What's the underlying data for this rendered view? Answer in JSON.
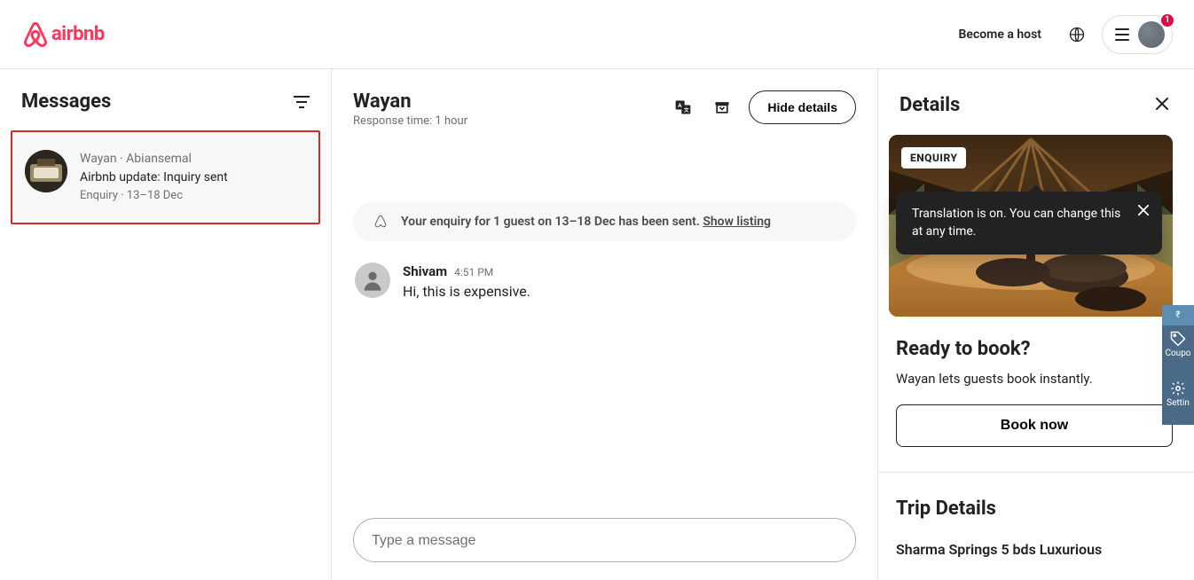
{
  "header": {
    "brand": "airbnb",
    "become_host": "Become a host",
    "badge_count": "1"
  },
  "sidebar": {
    "title": "Messages",
    "items": [
      {
        "line1": "Wayan · Abiansemal",
        "line2": "Airbnb update: Inquiry sent",
        "line3": "Enquiry · 13–18 Dec"
      }
    ]
  },
  "conversation": {
    "name": "Wayan",
    "subtitle": "Response time: 1 hour",
    "hide_details_label": "Hide details",
    "tooltip_text": "Translation is on. You can change this at any time.",
    "enquiry_banner_text": "Your enquiry for 1 guest on 13–18 Dec has been sent.",
    "enquiry_banner_link": "Show listing",
    "messages": [
      {
        "sender": "Shivam",
        "time": "4:51 PM",
        "text": "Hi, this is expensive."
      }
    ],
    "compose_placeholder": "Type a message"
  },
  "details": {
    "title": "Details",
    "enquiry_tag": "ENQUIRY",
    "ready_title": "Ready to book?",
    "ready_text": "Wayan lets guests book instantly.",
    "book_now_label": "Book now",
    "trip_title": "Trip Details",
    "listing_name": "Sharma Springs 5 bds Luxurious"
  },
  "edge_tabs": {
    "currency": "₹",
    "coupon": "Coupo",
    "settings": "Settin"
  }
}
